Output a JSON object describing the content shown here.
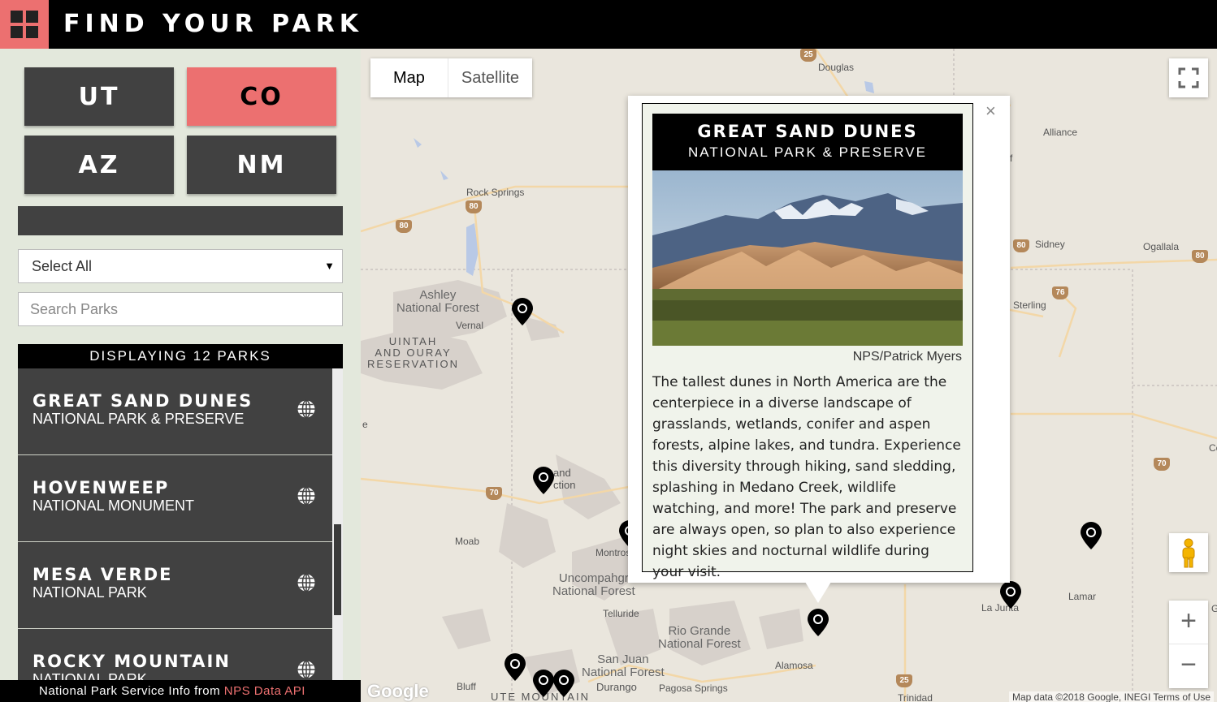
{
  "header": {
    "title": "FIND YOUR PARK"
  },
  "sidebar": {
    "states": [
      {
        "label": "UT",
        "active": false
      },
      {
        "label": "CO",
        "active": true
      },
      {
        "label": "AZ",
        "active": false
      },
      {
        "label": "NM",
        "active": false
      }
    ],
    "select": {
      "value": "Select All"
    },
    "search": {
      "placeholder": "Search Parks"
    },
    "count_label": "DISPLAYING 12 PARKS",
    "parks": [
      {
        "name": "GREAT SAND DUNES",
        "type": "NATIONAL PARK & PRESERVE"
      },
      {
        "name": "HOVENWEEP",
        "type": "NATIONAL MONUMENT"
      },
      {
        "name": "MESA VERDE",
        "type": "NATIONAL PARK"
      },
      {
        "name": "ROCKY MOUNTAIN",
        "type": "NATIONAL PARK"
      }
    ],
    "footer": {
      "text": "National Park Service Info from ",
      "link": "NPS Data API"
    }
  },
  "map": {
    "type_buttons": {
      "map": "Map",
      "satellite": "Satellite"
    },
    "zoom": {
      "in": "+",
      "out": "−"
    },
    "google": "Google",
    "attribution": "Map data ©2018 Google, INEGI    Terms of Use",
    "labels": {
      "douglas": "Douglas",
      "alliance": "Alliance",
      "rock_springs": "Rock Springs",
      "sidney": "Sidney",
      "ogallala": "Ogallala",
      "ashley": "Ashley\nNational Forest",
      "vernal": "Vernal",
      "sterling": "Sterling",
      "uintah": "UINTAH\nAND OURAY\nRESERVATION",
      "grand_junction": "and\nction",
      "moab": "Moab",
      "montrose": "Montros",
      "uncompahgre": "Uncompahgr\nNational Forest",
      "telluride": "Telluride",
      "rio_grande": "Rio Grande\nNational Forest",
      "san_juan": "San Juan\nNational Forest",
      "durango": "Durango",
      "pagosa": "Pagosa Springs",
      "alamosa": "Alamosa",
      "la_junta": "La Junta",
      "lamar": "Lamar",
      "bluff": "Bluff",
      "ute_mountain": "UTE MOUNTAIN",
      "trinidad": "Trinidad",
      "edge_e": "e",
      "edge_f": "f",
      "edge_co": "Co",
      "edge_g": "G"
    },
    "highways": {
      "h25a": "25",
      "h80a": "80",
      "h80b": "80",
      "h80c": "80",
      "h80d": "80",
      "h76": "76",
      "h70a": "70",
      "h70b": "70",
      "h25b": "25"
    }
  },
  "info_window": {
    "title": "GREAT SAND DUNES",
    "subtitle": "NATIONAL PARK & PRESERVE",
    "credit": "NPS/Patrick Myers",
    "description": "The tallest dunes in North America are the centerpiece in a diverse landscape of grasslands, wetlands, conifer and aspen forests, alpine lakes, and tundra. Experience this diversity through hiking, sand sledding, splashing in Medano Creek, wildlife watching, and more! The park and preserve are always open, so plan to also experience night skies and nocturnal wildlife during your visit.",
    "close": "×"
  },
  "colors": {
    "accent": "#ec7070",
    "dark": "#414141",
    "sidebar_bg": "#e3e8dc",
    "info_bg": "#f0f3eb"
  }
}
